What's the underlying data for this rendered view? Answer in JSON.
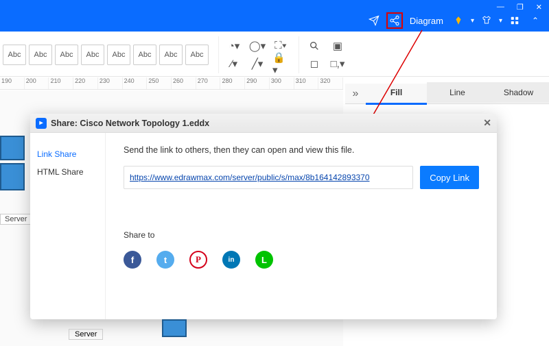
{
  "titlebar": {
    "diagram_label": "Diagram",
    "minimize": "—",
    "maximize": "❐",
    "close": "✕"
  },
  "ribbon": {
    "abc_label": "Abc",
    "abc_count": 8
  },
  "ruler": {
    "ticks": [
      "190",
      "200",
      "210",
      "220",
      "230",
      "240",
      "250",
      "260",
      "270",
      "280",
      "290",
      "300",
      "310",
      "320"
    ]
  },
  "prop_tabs": {
    "collapse": "»",
    "items": [
      {
        "label": "Fill",
        "active": true
      },
      {
        "label": "Line",
        "active": false
      },
      {
        "label": "Shadow",
        "active": false
      }
    ]
  },
  "canvas": {
    "server_label": "Server"
  },
  "dialog": {
    "title": "Share: Cisco Network Topology 1.eddx",
    "tabs": {
      "link": "Link Share",
      "html": "HTML Share"
    },
    "instruction": "Send the link to others, then they can open and view this file.",
    "url": "https://www.edrawmax.com/server/public/s/max/8b164142893370",
    "copy": "Copy Link",
    "share_to": "Share to",
    "social": [
      {
        "name": "facebook",
        "color": "#3b5998",
        "glyph": "f"
      },
      {
        "name": "twitter",
        "color": "#55acee",
        "glyph": "t"
      },
      {
        "name": "pinterest",
        "color": "#fff",
        "glyph": "p"
      },
      {
        "name": "linkedin",
        "color": "#0077b5",
        "glyph": "in"
      },
      {
        "name": "line",
        "color": "#00c300",
        "glyph": "L"
      }
    ]
  },
  "bottom": {
    "server": "Server"
  }
}
